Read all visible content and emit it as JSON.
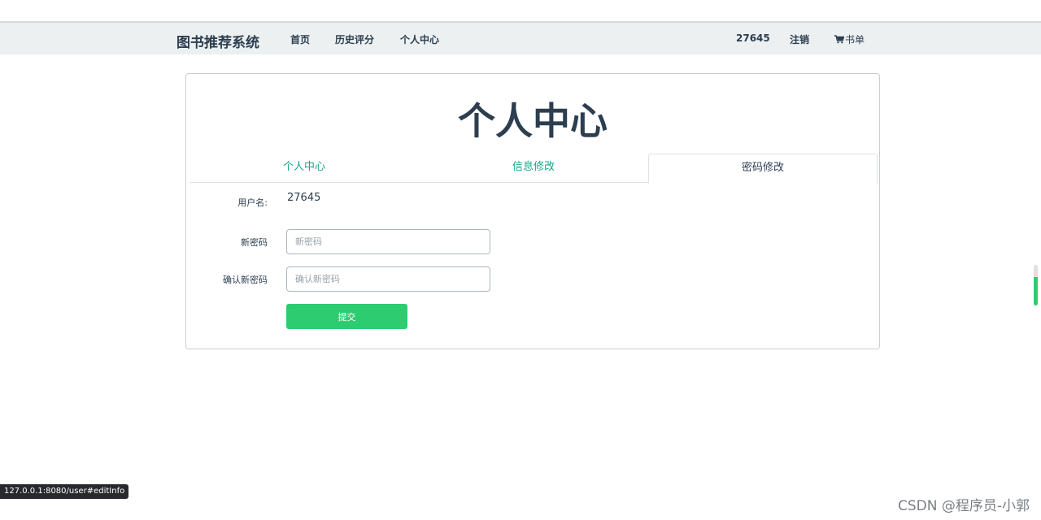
{
  "navbar": {
    "brand": "图书推荐系统",
    "links": [
      "首页",
      "历史评分",
      "个人中心"
    ],
    "username": "27645",
    "logout": "注销",
    "cart": "书单"
  },
  "panel": {
    "title": "个人中心",
    "tabs": [
      "个人中心",
      "信息修改",
      "密码修改"
    ],
    "active_tab": "密码修改",
    "form": {
      "username_label": "用户名:",
      "username_value": "27645",
      "new_password_label": "新密码",
      "new_password_placeholder": "新密码",
      "confirm_password_label": "确认新密码",
      "confirm_password_placeholder": "确认新密码",
      "submit_label": "提交"
    }
  },
  "status_url": "127.0.0.1:8080/user#editInfo",
  "watermark": "CSDN @程序员-小郭",
  "colors": {
    "accent": "#2ecc71",
    "tab_link": "#18a689",
    "text": "#2c3e50",
    "navbar_bg": "#ecf0f1"
  },
  "icons": {
    "cart": "cart-icon"
  }
}
